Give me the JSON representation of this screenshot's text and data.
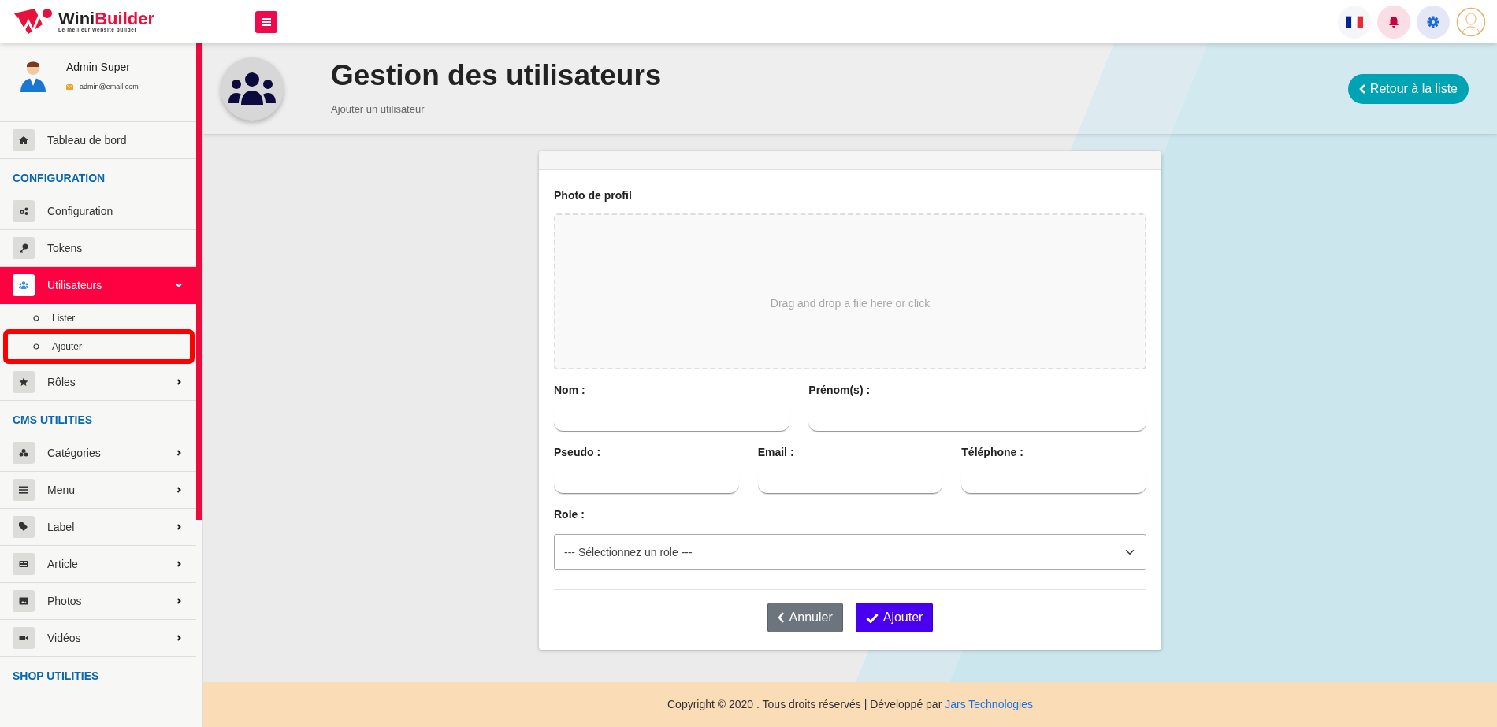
{
  "topbar": {
    "logo": {
      "name_first": "Wini",
      "name_second": "Builder",
      "tagline": "Le meilleur website builder"
    }
  },
  "sidebar": {
    "user": {
      "name": "Admin Super",
      "email": "admin@email.com"
    },
    "items": [
      {
        "kind": "link",
        "label": "Tableau de bord",
        "selected": false
      },
      {
        "kind": "section",
        "label": "CONFIGURATION"
      },
      {
        "kind": "link",
        "label": "Configuration",
        "selected": false
      },
      {
        "kind": "link",
        "label": "Tokens",
        "selected": false
      },
      {
        "kind": "link",
        "label": "Utilisateurs",
        "selected": true,
        "expanded": true,
        "children": [
          {
            "label": "Lister",
            "highlighted": false
          },
          {
            "label": "Ajouter",
            "highlighted": true
          }
        ]
      },
      {
        "kind": "link",
        "label": "Rôles",
        "selected": false,
        "expanded": false
      },
      {
        "kind": "section",
        "label": "CMS UTILITIES"
      },
      {
        "kind": "link",
        "label": "Catégories",
        "selected": false,
        "expanded": false
      },
      {
        "kind": "link",
        "label": "Menu",
        "selected": false,
        "expanded": false
      },
      {
        "kind": "link",
        "label": "Label",
        "selected": false,
        "expanded": false
      },
      {
        "kind": "link",
        "label": "Article",
        "selected": false,
        "expanded": false
      },
      {
        "kind": "link",
        "label": "Photos",
        "selected": false,
        "expanded": false
      },
      {
        "kind": "link",
        "label": "Vidéos",
        "selected": false,
        "expanded": false
      },
      {
        "kind": "section",
        "label": "SHOP UTILITIES"
      }
    ]
  },
  "header": {
    "title": "Gestion des utilisateurs",
    "subtitle": "Ajouter un utilisateur",
    "back_button": "Retour à la liste"
  },
  "form": {
    "photo_label": "Photo de profil",
    "dropzone_text": "Drag and drop a file here or click",
    "rows": [
      [
        {
          "label": "Nom :"
        },
        {
          "label": "Prénom(s) :"
        }
      ],
      [
        {
          "label": "Pseudo :"
        },
        {
          "label": "Email :"
        },
        {
          "label": "Téléphone :"
        }
      ]
    ],
    "role": {
      "label": "Role :",
      "placeholder": "--- Sélectionnez un role ---"
    },
    "buttons": [
      {
        "kind": "cancel",
        "label": "Annuler"
      },
      {
        "kind": "submit",
        "label": "Ajouter"
      }
    ]
  },
  "footer": {
    "text": "Copyright © 2020 . Tous droits réservés | Développé par",
    "link": "Jars Technologies"
  }
}
